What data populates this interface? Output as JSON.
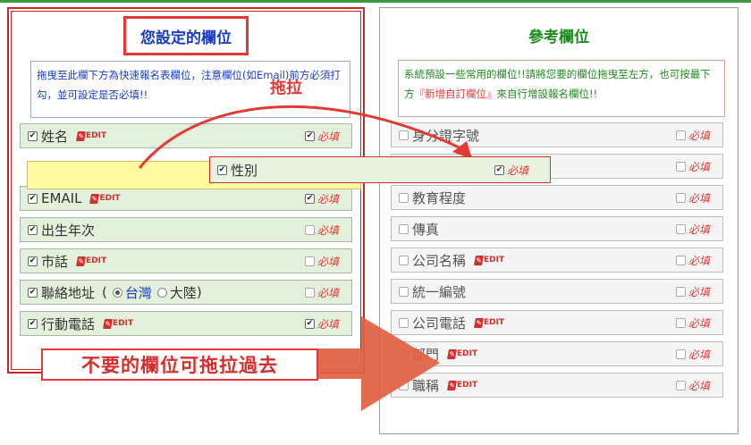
{
  "left_panel": {
    "title": "您設定的欄位",
    "note": "拖曳至此欄下方為快速報名表欄位，注意欄位(如Email)前方必須打勾，並可設定是否必填!!"
  },
  "right_panel": {
    "title": "參考欄位",
    "note_prefix": "系統預設一些常用的欄位!!請將您要的欄位拖曳至左方，也可按最下方",
    "note_highlight": "『新增自訂欄位』",
    "note_suffix": "來自行增設報名欄位!!"
  },
  "common": {
    "required_label": "必填",
    "edit_label": "EDIT",
    "check_glyph": "✔",
    "edit_icon": "pencil-icon"
  },
  "left_fields": [
    {
      "label": "姓名",
      "checked": true,
      "edit": true,
      "required": true
    },
    {
      "label": "EMAIL",
      "checked": true,
      "edit": true,
      "required": true
    },
    {
      "label": "出生年次",
      "checked": true,
      "edit": false,
      "required": false
    },
    {
      "label": "市話",
      "checked": true,
      "edit": true,
      "required": false
    },
    {
      "label": "聯絡地址",
      "checked": true,
      "edit": false,
      "required": false,
      "paren_open": "(",
      "paren_close": ")",
      "options": [
        "台灣",
        "大陸"
      ],
      "selected_option": "台灣"
    },
    {
      "label": "行動電話",
      "checked": true,
      "edit": true,
      "required": true
    }
  ],
  "dragged_field": {
    "label": "性別",
    "checked": true,
    "required": true
  },
  "right_fields": [
    {
      "label": "身分證字號",
      "checked": false,
      "edit": false,
      "required": false
    },
    {
      "label": "",
      "checked": false,
      "edit": false,
      "required": false
    },
    {
      "label": "教育程度",
      "checked": false,
      "edit": false,
      "required": false
    },
    {
      "label": "傳真",
      "checked": false,
      "edit": false,
      "required": false
    },
    {
      "label": "公司名稱",
      "checked": false,
      "edit": true,
      "required": false
    },
    {
      "label": "統一編號",
      "checked": false,
      "edit": false,
      "required": false
    },
    {
      "label": "公司電話",
      "checked": false,
      "edit": true,
      "required": false
    },
    {
      "label": "部門",
      "checked": false,
      "edit": true,
      "required": false
    },
    {
      "label": "職稱",
      "checked": false,
      "edit": true,
      "required": false
    }
  ],
  "annotations": {
    "drag_label": "拖拉",
    "callout": "不要的欄位可拖拉過去",
    "arrow_color": "#e06040",
    "accent_red": "#e53935"
  }
}
